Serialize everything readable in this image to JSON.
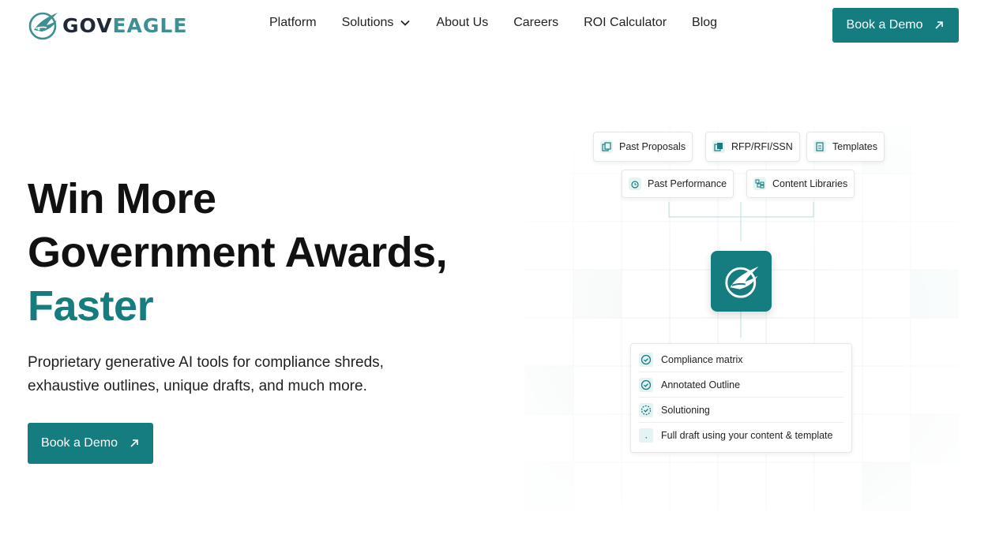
{
  "brand": {
    "gov": "GOV",
    "eagle": "EAGLE",
    "accent_color": "#157c80"
  },
  "nav": {
    "items": [
      {
        "label": "Platform"
      },
      {
        "label": "Solutions",
        "has_dropdown": true
      },
      {
        "label": "About Us"
      },
      {
        "label": "Careers"
      },
      {
        "label": "ROI Calculator"
      },
      {
        "label": "Blog"
      }
    ],
    "cta_label": "Book a Demo"
  },
  "hero": {
    "title_line1": "Win More",
    "title_line2": "Government Awards,",
    "title_accent": "Faster",
    "subtitle": "Proprietary generative AI tools for compliance shreds, exhaustive outlines, unique drafts, and much more.",
    "cta_label": "Book a Demo"
  },
  "illustration": {
    "inputs": [
      {
        "label": "Past Proposals",
        "icon": "copy-icon"
      },
      {
        "label": "RFP/RFI/SSN",
        "icon": "documents-icon"
      },
      {
        "label": "Templates",
        "icon": "file-icon"
      },
      {
        "label": "Past Performance",
        "icon": "history-icon"
      },
      {
        "label": "Content Libraries",
        "icon": "library-icon"
      }
    ],
    "hub_icon": "eagle-logo-icon",
    "outputs": [
      {
        "label": "Compliance matrix",
        "icon": "check-circle-icon"
      },
      {
        "label": "Annotated Outline",
        "icon": "check-circle-icon"
      },
      {
        "label": "Solutioning",
        "icon": "check-circle-icon"
      },
      {
        "label": "Full draft using your content & template",
        "icon": "loading-icon"
      }
    ]
  }
}
